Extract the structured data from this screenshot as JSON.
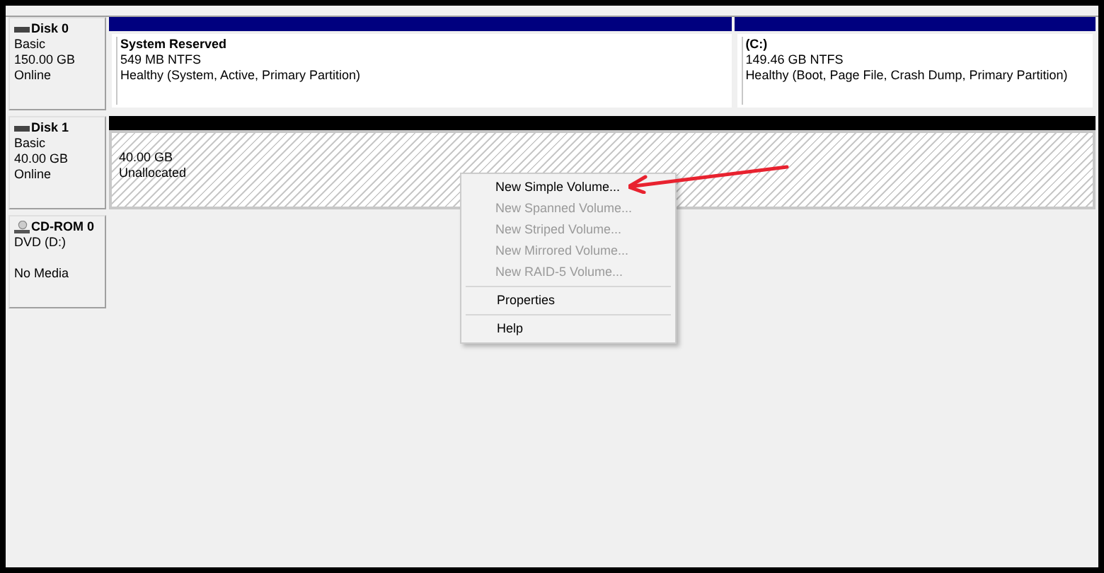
{
  "disks": [
    {
      "name": "Disk 0",
      "kind": "disk",
      "details": [
        "Basic",
        "150.00 GB",
        "Online"
      ],
      "partitions": [
        {
          "kind": "primary",
          "title": "System Reserved",
          "lines": [
            "549 MB NTFS",
            "Healthy (System, Active, Primary Partition)"
          ]
        },
        {
          "kind": "primary",
          "title": "(C:)",
          "lines": [
            "149.46 GB NTFS",
            "Healthy (Boot, Page File, Crash Dump, Primary Partition)"
          ]
        }
      ]
    },
    {
      "name": "Disk 1",
      "kind": "disk",
      "details": [
        "Basic",
        "40.00 GB",
        "Online"
      ],
      "partitions": [
        {
          "kind": "unallocated",
          "lines": [
            "40.00 GB",
            "Unallocated"
          ]
        }
      ]
    },
    {
      "name": "CD-ROM 0",
      "kind": "cdrom",
      "details": [
        "DVD (D:)",
        "No Media"
      ]
    }
  ],
  "context_menu": {
    "sections": [
      [
        {
          "label": "New Simple Volume...",
          "disabled": false
        },
        {
          "label": "New Spanned Volume...",
          "disabled": true
        },
        {
          "label": "New Striped Volume...",
          "disabled": true
        },
        {
          "label": "New Mirrored Volume...",
          "disabled": true
        },
        {
          "label": "New RAID-5 Volume...",
          "disabled": true
        }
      ],
      [
        {
          "label": "Properties",
          "disabled": false
        }
      ],
      [
        {
          "label": "Help",
          "disabled": false
        }
      ]
    ]
  }
}
